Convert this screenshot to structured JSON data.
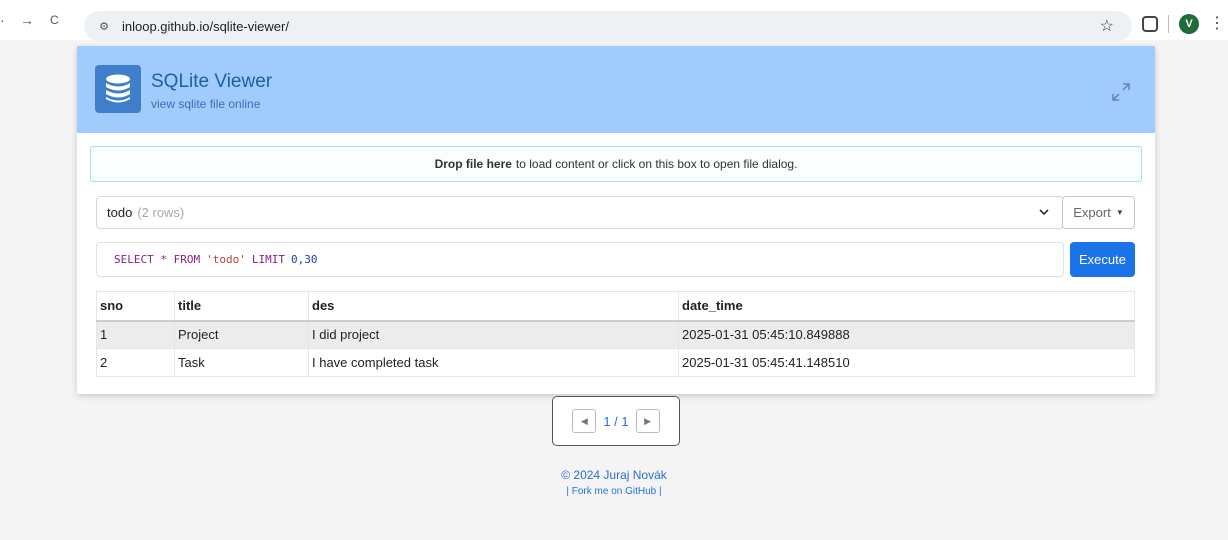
{
  "browser": {
    "back_icon": "back-arrow-icon",
    "forward_glyph": "→",
    "reload_glyph": "C",
    "site_info_glyph": "⚙",
    "url": "inloop.github.io/sqlite-viewer/",
    "profile_initial": "V"
  },
  "app": {
    "title": "SQLite Viewer",
    "subtitle": "view sqlite file online"
  },
  "dropzone": {
    "bold_text": "Drop file here",
    "text": "to load content or click on this box to open file dialog."
  },
  "table_select": {
    "name": "todo",
    "count": "(2 rows)"
  },
  "export_label": "Export",
  "query": {
    "keyword_part": "SELECT * FROM",
    "table_part": "'todo'",
    "limit_part": "LIMIT",
    "number_part": "0,30"
  },
  "execute_label": "Execute",
  "results": {
    "columns": [
      "sno",
      "title",
      "des",
      "date_time"
    ],
    "rows": [
      [
        "1",
        "Project",
        "I did project",
        "2025-01-31 05:45:10.849888"
      ],
      [
        "2",
        "Task",
        "I have completed task",
        "2025-01-31 05:45:41.148510"
      ]
    ]
  },
  "pager": {
    "text": "1 / 1"
  },
  "footer": {
    "copyright": "© 2024 Juraj Novák",
    "fork": "| Fork me on GitHub |"
  },
  "colors": {
    "header_bg": "#a0cbfc",
    "accent": "#1a73e8",
    "logo_bg": "#3e7ecb"
  }
}
